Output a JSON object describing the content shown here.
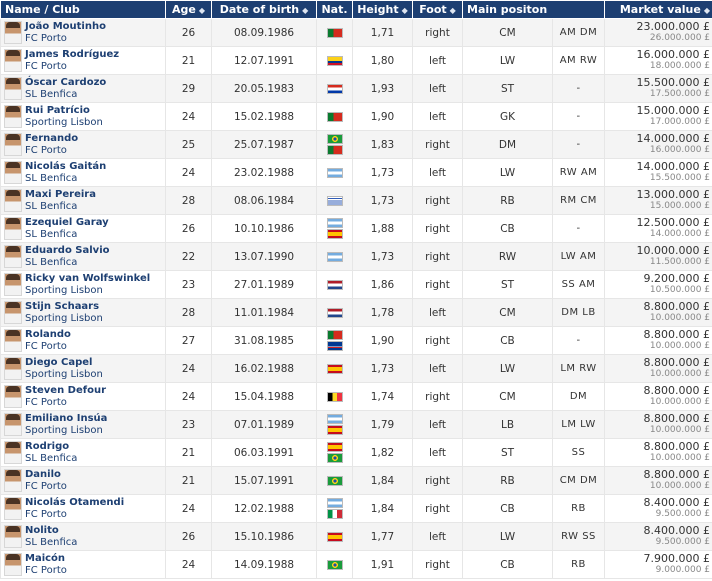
{
  "headers": {
    "name": "Name / Club",
    "age": "Age",
    "dob": "Date of birth",
    "nat": "Nat.",
    "height": "Height",
    "foot": "Foot",
    "position": "Main positon",
    "value": "Market value"
  },
  "sort_glyph": "◆",
  "flag_colors": {
    "por": "linear-gradient(90deg,#0a7a2f 0 40%,#d52b1e 40%)",
    "col": "linear-gradient(#fcd116 0 50%,#003893 50% 75%,#ce1126 75%)",
    "par": "linear-gradient(#d52b1e 0 33%,#ffffff 33% 66%,#0038a8 66%)",
    "bra": "radial-gradient(circle at 50% 50%,#1f4aa8 0 18%,#f7d417 19% 36%,#1a9b3c 37%)",
    "arg": "linear-gradient(#74acdf 0 33%,#ffffff 33% 66%,#74acdf 66%)",
    "uru": "repeating-linear-gradient(#ffffff 0 1.1px,#2f5bb7 1.1px 2.2px)",
    "esp": "linear-gradient(#c60b1e 0 25%,#ffc400 25% 75%,#c60b1e 75%)",
    "ned": "linear-gradient(#ae1c28 0 33%,#ffffff 33% 66%,#21468b 66%)",
    "cpv": "linear-gradient(#003893 0 55%,#ffffff 55% 65%,#cf2027 65% 75%,#003893 75%)",
    "bel": "linear-gradient(90deg,#000000 0 33%,#fdda24 33% 66%,#ef3340 66%)",
    "ita": "linear-gradient(90deg,#009246 0 33%,#ffffff 33% 66%,#ce2b37 66%)"
  },
  "players": [
    {
      "name": "João Moutinho",
      "club": "FC Porto",
      "age": "26",
      "dob": "08.09.1986",
      "nat": [
        "por"
      ],
      "height": "1,71",
      "foot": "right",
      "pos": "CM",
      "alt": "AM   DM",
      "value": "23.000.000 £",
      "prev": "26.000.000 £"
    },
    {
      "name": "James Rodríguez",
      "club": "FC Porto",
      "age": "21",
      "dob": "12.07.1991",
      "nat": [
        "col"
      ],
      "height": "1,80",
      "foot": "left",
      "pos": "LW",
      "alt": "AM   RW",
      "value": "16.000.000 £",
      "prev": "18.000.000 £"
    },
    {
      "name": "Óscar Cardozo",
      "club": "SL Benfica",
      "age": "29",
      "dob": "20.05.1983",
      "nat": [
        "par"
      ],
      "height": "1,93",
      "foot": "left",
      "pos": "ST",
      "alt": "-",
      "value": "15.500.000 £",
      "prev": "17.500.000 £"
    },
    {
      "name": "Rui Patrício",
      "club": "Sporting Lisbon",
      "age": "24",
      "dob": "15.02.1988",
      "nat": [
        "por"
      ],
      "height": "1,90",
      "foot": "left",
      "pos": "GK",
      "alt": "-",
      "value": "15.000.000 £",
      "prev": "17.000.000 £"
    },
    {
      "name": "Fernando",
      "club": "FC Porto",
      "age": "25",
      "dob": "25.07.1987",
      "nat": [
        "bra",
        "por"
      ],
      "height": "1,83",
      "foot": "right",
      "pos": "DM",
      "alt": "-",
      "value": "14.000.000 £",
      "prev": "16.000.000 £"
    },
    {
      "name": "Nicolás Gaitán",
      "club": "SL Benfica",
      "age": "24",
      "dob": "23.02.1988",
      "nat": [
        "arg"
      ],
      "height": "1,73",
      "foot": "left",
      "pos": "LW",
      "alt": "RW   AM",
      "value": "14.000.000 £",
      "prev": "15.500.000 £"
    },
    {
      "name": "Maxi Pereira",
      "club": "SL Benfica",
      "age": "28",
      "dob": "08.06.1984",
      "nat": [
        "uru"
      ],
      "height": "1,73",
      "foot": "right",
      "pos": "RB",
      "alt": "RM   CM",
      "value": "13.000.000 £",
      "prev": "15.000.000 £"
    },
    {
      "name": "Ezequiel Garay",
      "club": "SL Benfica",
      "age": "26",
      "dob": "10.10.1986",
      "nat": [
        "arg",
        "esp"
      ],
      "height": "1,88",
      "foot": "right",
      "pos": "CB",
      "alt": "-",
      "value": "12.500.000 £",
      "prev": "14.000.000 £"
    },
    {
      "name": "Eduardo Salvio",
      "club": "SL Benfica",
      "age": "22",
      "dob": "13.07.1990",
      "nat": [
        "arg"
      ],
      "height": "1,73",
      "foot": "right",
      "pos": "RW",
      "alt": "LW   AM",
      "value": "10.000.000 £",
      "prev": "11.500.000 £"
    },
    {
      "name": "Ricky van Wolfswinkel",
      "club": "Sporting Lisbon",
      "age": "23",
      "dob": "27.01.1989",
      "nat": [
        "ned"
      ],
      "height": "1,86",
      "foot": "right",
      "pos": "ST",
      "alt": "SS   AM",
      "value": "9.200.000 £",
      "prev": "10.500.000 £"
    },
    {
      "name": "Stijn Schaars",
      "club": "Sporting Lisbon",
      "age": "28",
      "dob": "11.01.1984",
      "nat": [
        "ned"
      ],
      "height": "1,78",
      "foot": "left",
      "pos": "CM",
      "alt": "DM   LB",
      "value": "8.800.000 £",
      "prev": "10.000.000 £"
    },
    {
      "name": "Rolando",
      "club": "FC Porto",
      "age": "27",
      "dob": "31.08.1985",
      "nat": [
        "por",
        "cpv"
      ],
      "height": "1,90",
      "foot": "right",
      "pos": "CB",
      "alt": "-",
      "value": "8.800.000 £",
      "prev": "10.000.000 £"
    },
    {
      "name": "Diego Capel",
      "club": "Sporting Lisbon",
      "age": "24",
      "dob": "16.02.1988",
      "nat": [
        "esp"
      ],
      "height": "1,73",
      "foot": "left",
      "pos": "LW",
      "alt": "LM   RW",
      "value": "8.800.000 £",
      "prev": "10.000.000 £"
    },
    {
      "name": "Steven Defour",
      "club": "FC Porto",
      "age": "24",
      "dob": "15.04.1988",
      "nat": [
        "bel"
      ],
      "height": "1,74",
      "foot": "right",
      "pos": "CM",
      "alt": "DM",
      "value": "8.800.000 £",
      "prev": "10.000.000 £"
    },
    {
      "name": "Emiliano Insúa",
      "club": "Sporting Lisbon",
      "age": "23",
      "dob": "07.01.1989",
      "nat": [
        "arg",
        "esp"
      ],
      "height": "1,79",
      "foot": "left",
      "pos": "LB",
      "alt": "LM   LW",
      "value": "8.800.000 £",
      "prev": "10.000.000 £"
    },
    {
      "name": "Rodrigo",
      "club": "SL Benfica",
      "age": "21",
      "dob": "06.03.1991",
      "nat": [
        "esp",
        "bra"
      ],
      "height": "1,82",
      "foot": "left",
      "pos": "ST",
      "alt": "SS",
      "value": "8.800.000 £",
      "prev": "10.000.000 £"
    },
    {
      "name": "Danilo",
      "club": "FC Porto",
      "age": "21",
      "dob": "15.07.1991",
      "nat": [
        "bra"
      ],
      "height": "1,84",
      "foot": "right",
      "pos": "RB",
      "alt": "CM   DM",
      "value": "8.800.000 £",
      "prev": "10.000.000 £"
    },
    {
      "name": "Nicolás Otamendi",
      "club": "FC Porto",
      "age": "24",
      "dob": "12.02.1988",
      "nat": [
        "arg",
        "ita"
      ],
      "height": "1,84",
      "foot": "right",
      "pos": "CB",
      "alt": "RB",
      "value": "8.400.000 £",
      "prev": "9.500.000 £"
    },
    {
      "name": "Nolito",
      "club": "SL Benfica",
      "age": "26",
      "dob": "15.10.1986",
      "nat": [
        "esp"
      ],
      "height": "1,77",
      "foot": "left",
      "pos": "LW",
      "alt": "RW   SS",
      "value": "8.400.000 £",
      "prev": "9.500.000 £"
    },
    {
      "name": "Maicón",
      "club": "FC Porto",
      "age": "24",
      "dob": "14.09.1988",
      "nat": [
        "bra"
      ],
      "height": "1,91",
      "foot": "right",
      "pos": "CB",
      "alt": "RB",
      "value": "7.900.000 £",
      "prev": "9.000.000 £"
    }
  ]
}
